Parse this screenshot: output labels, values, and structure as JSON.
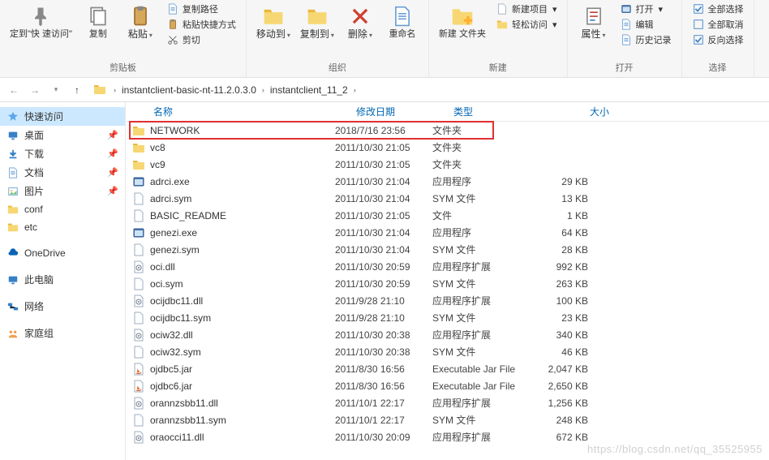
{
  "ribbon": {
    "pin": {
      "pin_to_quick": "定到\"快\n速访问\"",
      "copy": "复制",
      "paste": "粘贴",
      "copy_path": "复制路径",
      "paste_shortcut": "粘贴快捷方式",
      "cut": "剪切",
      "group": "剪贴板"
    },
    "organize": {
      "move_to": "移动到",
      "copy_to": "复制到",
      "delete": "删除",
      "rename": "重命名",
      "group": "组织"
    },
    "new": {
      "new_folder": "新建\n文件夹",
      "new_item": "新建项目",
      "easy_access": "轻松访问",
      "group": "新建"
    },
    "open": {
      "properties": "属性",
      "open": "打开",
      "edit": "编辑",
      "history": "历史记录",
      "group": "打开"
    },
    "select": {
      "select_all": "全部选择",
      "select_none": "全部取消",
      "invert": "反向选择",
      "group": "选择"
    }
  },
  "breadcrumb": {
    "items": [
      "instantclient-basic-nt-11.2.0.3.0",
      "instantclient_11_2"
    ]
  },
  "nav": {
    "quick_access": "快速访问",
    "desktop": "桌面",
    "downloads": "下载",
    "documents": "文档",
    "pictures": "图片",
    "conf": "conf",
    "etc": "etc",
    "onedrive": "OneDrive",
    "this_pc": "此电脑",
    "network": "网络",
    "homegroup": "家庭组"
  },
  "columns": {
    "name": "名称",
    "date": "修改日期",
    "type": "类型",
    "size": "大小"
  },
  "highlight_index": 0,
  "files": [
    {
      "icon": "folder",
      "name": "NETWORK",
      "date": "2018/7/16 23:56",
      "type": "文件夹",
      "size": ""
    },
    {
      "icon": "folder",
      "name": "vc8",
      "date": "2011/10/30 21:05",
      "type": "文件夹",
      "size": ""
    },
    {
      "icon": "folder",
      "name": "vc9",
      "date": "2011/10/30 21:05",
      "type": "文件夹",
      "size": ""
    },
    {
      "icon": "exe",
      "name": "adrci.exe",
      "date": "2011/10/30 21:04",
      "type": "应用程序",
      "size": "29 KB"
    },
    {
      "icon": "file",
      "name": "adrci.sym",
      "date": "2011/10/30 21:04",
      "type": "SYM 文件",
      "size": "13 KB"
    },
    {
      "icon": "file",
      "name": "BASIC_README",
      "date": "2011/10/30 21:05",
      "type": "文件",
      "size": "1 KB"
    },
    {
      "icon": "exe",
      "name": "genezi.exe",
      "date": "2011/10/30 21:04",
      "type": "应用程序",
      "size": "64 KB"
    },
    {
      "icon": "file",
      "name": "genezi.sym",
      "date": "2011/10/30 21:04",
      "type": "SYM 文件",
      "size": "28 KB"
    },
    {
      "icon": "dll",
      "name": "oci.dll",
      "date": "2011/10/30 20:59",
      "type": "应用程序扩展",
      "size": "992 KB"
    },
    {
      "icon": "file",
      "name": "oci.sym",
      "date": "2011/10/30 20:59",
      "type": "SYM 文件",
      "size": "263 KB"
    },
    {
      "icon": "dll",
      "name": "ocijdbc11.dll",
      "date": "2011/9/28 21:10",
      "type": "应用程序扩展",
      "size": "100 KB"
    },
    {
      "icon": "file",
      "name": "ocijdbc11.sym",
      "date": "2011/9/28 21:10",
      "type": "SYM 文件",
      "size": "23 KB"
    },
    {
      "icon": "dll",
      "name": "ociw32.dll",
      "date": "2011/10/30 20:38",
      "type": "应用程序扩展",
      "size": "340 KB"
    },
    {
      "icon": "file",
      "name": "ociw32.sym",
      "date": "2011/10/30 20:38",
      "type": "SYM 文件",
      "size": "46 KB"
    },
    {
      "icon": "jar",
      "name": "ojdbc5.jar",
      "date": "2011/8/30 16:56",
      "type": "Executable Jar File",
      "size": "2,047 KB"
    },
    {
      "icon": "jar",
      "name": "ojdbc6.jar",
      "date": "2011/8/30 16:56",
      "type": "Executable Jar File",
      "size": "2,650 KB"
    },
    {
      "icon": "dll",
      "name": "orannzsbb11.dll",
      "date": "2011/10/1 22:17",
      "type": "应用程序扩展",
      "size": "1,256 KB"
    },
    {
      "icon": "file",
      "name": "orannzsbb11.sym",
      "date": "2011/10/1 22:17",
      "type": "SYM 文件",
      "size": "248 KB"
    },
    {
      "icon": "dll",
      "name": "oraocci11.dll",
      "date": "2011/10/30 20:09",
      "type": "应用程序扩展",
      "size": "672 KB"
    }
  ],
  "watermark": "https://blog.csdn.net/qq_35525955"
}
